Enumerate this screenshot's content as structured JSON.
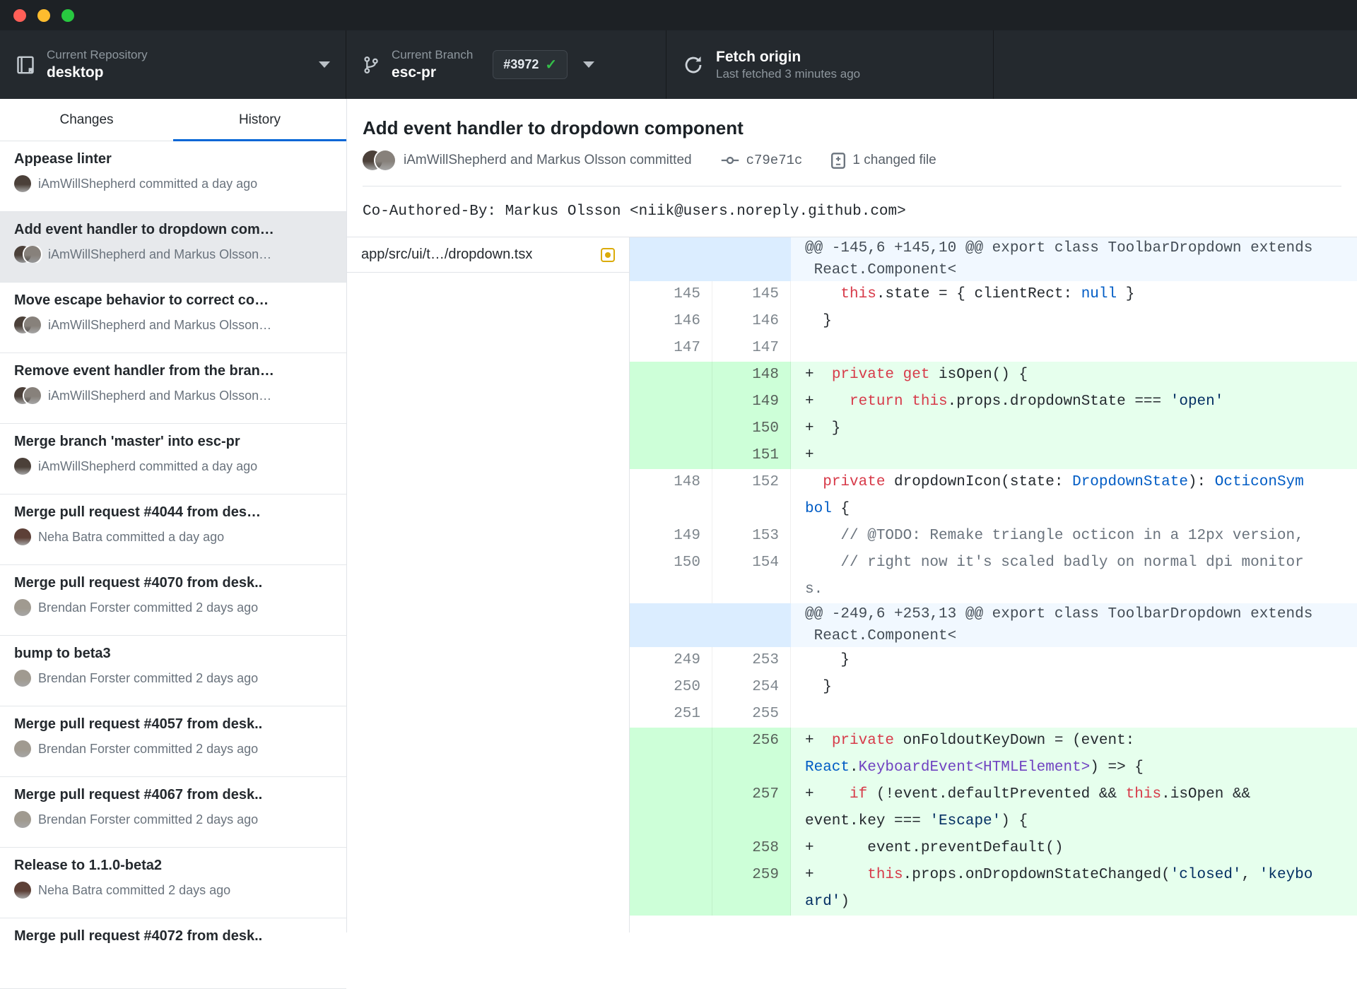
{
  "toolbar": {
    "repository": {
      "label": "Current Repository",
      "value": "desktop"
    },
    "branch": {
      "label": "Current Branch",
      "value": "esc-pr",
      "badge": "#3972",
      "check": "✓"
    },
    "fetch": {
      "title": "Fetch origin",
      "subtitle": "Last fetched 3 minutes ago"
    }
  },
  "sidebar": {
    "tabs": [
      {
        "label": "Changes",
        "active": false
      },
      {
        "label": "History",
        "active": true
      }
    ],
    "history": [
      {
        "title": "Appease linter",
        "meta": "iAmWillShepherd committed a day ago",
        "avatars": [
          "iAmWillShepherd"
        ],
        "selected": false
      },
      {
        "title": "Add event handler to dropdown com…",
        "meta": "iAmWillShepherd and Markus Olsson…",
        "avatars": [
          "iAmWillShepherd",
          "MarkusOlsson"
        ],
        "selected": true
      },
      {
        "title": "Move escape behavior to correct co…",
        "meta": "iAmWillShepherd and Markus Olsson…",
        "avatars": [
          "iAmWillShepherd",
          "MarkusOlsson"
        ],
        "selected": false
      },
      {
        "title": "Remove event handler from the bran…",
        "meta": "iAmWillShepherd and Markus Olsson…",
        "avatars": [
          "iAmWillShepherd",
          "MarkusOlsson"
        ],
        "selected": false
      },
      {
        "title": "Merge branch 'master' into esc-pr",
        "meta": "iAmWillShepherd committed a day ago",
        "avatars": [
          "iAmWillShepherd"
        ],
        "selected": false
      },
      {
        "title": "Merge pull request #4044 from des…",
        "meta": "Neha Batra committed a day ago",
        "avatars": [
          "NehaBatra"
        ],
        "selected": false
      },
      {
        "title": "Merge pull request #4070 from desk..",
        "meta": "Brendan Forster committed 2 days ago",
        "avatars": [
          "BrendanForster"
        ],
        "selected": false
      },
      {
        "title": "bump to beta3",
        "meta": "Brendan Forster committed 2 days ago",
        "avatars": [
          "BrendanForster"
        ],
        "selected": false
      },
      {
        "title": "Merge pull request #4057 from desk..",
        "meta": "Brendan Forster committed 2 days ago",
        "avatars": [
          "BrendanForster"
        ],
        "selected": false
      },
      {
        "title": "Merge pull request #4067 from desk..",
        "meta": "Brendan Forster committed 2 days ago",
        "avatars": [
          "BrendanForster"
        ],
        "selected": false
      },
      {
        "title": "Release to 1.1.0-beta2",
        "meta": "Neha Batra committed 2 days ago",
        "avatars": [
          "NehaBatra"
        ],
        "selected": false
      },
      {
        "title": "Merge pull request #4072 from desk..",
        "meta": "",
        "avatars": [],
        "selected": false
      }
    ]
  },
  "commit": {
    "title": "Add event handler to dropdown component",
    "byline": "iAmWillShepherd and Markus Olsson committed",
    "byline_avatars": [
      "iAmWillShepherd",
      "MarkusOlsson"
    ],
    "sha": "c79e71c",
    "files_changed": "1 changed file",
    "description": "Co-Authored-By: Markus Olsson <niik@users.noreply.github.com>"
  },
  "diff": {
    "file": {
      "path": "app/src/ui/t…/dropdown.tsx",
      "status": "modified"
    },
    "rows": [
      {
        "kind": "hunk",
        "old": "",
        "new": "",
        "lines": [
          [
            [
              "h",
              "@@ -145,6 +145,10 @@ export class ToolbarDropdown extends"
            ]
          ],
          [
            [
              "h",
              " React.Component<"
            ]
          ]
        ]
      },
      {
        "kind": "ctx",
        "old": "145",
        "new": "145",
        "lines": [
          [
            [
              "p",
              "    "
            ],
            [
              "k",
              "this"
            ],
            [
              "p",
              ".state = { clientRect: "
            ],
            [
              "b",
              "null"
            ],
            [
              "p",
              " }"
            ]
          ]
        ]
      },
      {
        "kind": "ctx",
        "old": "146",
        "new": "146",
        "lines": [
          [
            [
              "p",
              "  }"
            ]
          ]
        ]
      },
      {
        "kind": "ctx",
        "old": "147",
        "new": "147",
        "lines": [
          [
            [
              "p",
              ""
            ]
          ]
        ]
      },
      {
        "kind": "add",
        "old": "",
        "new": "148",
        "lines": [
          [
            [
              "p",
              "+  "
            ],
            [
              "k",
              "private"
            ],
            [
              "p",
              " "
            ],
            [
              "k",
              "get"
            ],
            [
              "p",
              " isOpen() {"
            ]
          ]
        ]
      },
      {
        "kind": "add",
        "old": "",
        "new": "149",
        "lines": [
          [
            [
              "p",
              "+    "
            ],
            [
              "k",
              "return"
            ],
            [
              "p",
              " "
            ],
            [
              "k",
              "this"
            ],
            [
              "p",
              ".props.dropdownState === "
            ],
            [
              "s",
              "'open'"
            ]
          ]
        ]
      },
      {
        "kind": "add",
        "old": "",
        "new": "150",
        "lines": [
          [
            [
              "p",
              "+  }"
            ]
          ]
        ]
      },
      {
        "kind": "add",
        "old": "",
        "new": "151",
        "lines": [
          [
            [
              "p",
              "+"
            ]
          ]
        ]
      },
      {
        "kind": "ctx",
        "old": "148",
        "new": "152",
        "lines": [
          [
            [
              "p",
              "  "
            ],
            [
              "k",
              "private"
            ],
            [
              "p",
              " dropdownIcon(state: "
            ],
            [
              "b",
              "DropdownState"
            ],
            [
              "p",
              "): "
            ],
            [
              "b",
              "OcticonSym"
            ]
          ],
          [
            [
              "b",
              "bol"
            ],
            [
              "p",
              " {"
            ]
          ]
        ]
      },
      {
        "kind": "ctx",
        "old": "149",
        "new": "153",
        "lines": [
          [
            [
              "c",
              "    // @TODO: Remake triangle octicon in a 12px version,"
            ]
          ]
        ]
      },
      {
        "kind": "ctx",
        "old": "150",
        "new": "154",
        "lines": [
          [
            [
              "c",
              "    // right now it's scaled badly on normal dpi monitor"
            ]
          ],
          [
            [
              "c",
              "s."
            ]
          ]
        ]
      },
      {
        "kind": "hunk",
        "old": "",
        "new": "",
        "lines": [
          [
            [
              "h",
              "@@ -249,6 +253,13 @@ export class ToolbarDropdown extends"
            ]
          ],
          [
            [
              "h",
              " React.Component<"
            ]
          ]
        ]
      },
      {
        "kind": "ctx",
        "old": "249",
        "new": "253",
        "lines": [
          [
            [
              "p",
              "    }"
            ]
          ]
        ]
      },
      {
        "kind": "ctx",
        "old": "250",
        "new": "254",
        "lines": [
          [
            [
              "p",
              "  }"
            ]
          ]
        ]
      },
      {
        "kind": "ctx",
        "old": "251",
        "new": "255",
        "lines": [
          [
            [
              "p",
              ""
            ]
          ]
        ]
      },
      {
        "kind": "add",
        "old": "",
        "new": "256",
        "lines": [
          [
            [
              "p",
              "+  "
            ],
            [
              "k",
              "private"
            ],
            [
              "p",
              " onFoldoutKeyDown = (event:"
            ]
          ],
          [
            [
              "b",
              "React"
            ],
            [
              "p",
              "."
            ],
            [
              "u",
              "KeyboardEvent<HTMLElement>"
            ],
            [
              "p",
              ") => {"
            ]
          ]
        ]
      },
      {
        "kind": "add",
        "old": "",
        "new": "257",
        "lines": [
          [
            [
              "p",
              "+    "
            ],
            [
              "k",
              "if"
            ],
            [
              "p",
              " (!event.defaultPrevented && "
            ],
            [
              "k",
              "this"
            ],
            [
              "p",
              ".isOpen &&"
            ]
          ],
          [
            [
              "p",
              "event.key === "
            ],
            [
              "s",
              "'Escape'"
            ],
            [
              "p",
              ") {"
            ]
          ]
        ]
      },
      {
        "kind": "add",
        "old": "",
        "new": "258",
        "lines": [
          [
            [
              "p",
              "+      event.preventDefault()"
            ]
          ]
        ]
      },
      {
        "kind": "add",
        "old": "",
        "new": "259",
        "lines": [
          [
            [
              "p",
              "+      "
            ],
            [
              "k",
              "this"
            ],
            [
              "p",
              ".props.onDropdownStateChanged("
            ],
            [
              "s",
              "'closed'"
            ],
            [
              "p",
              ", "
            ],
            [
              "s",
              "'keybo"
            ]
          ],
          [
            [
              "s",
              "ard'"
            ],
            [
              "p",
              ")"
            ]
          ]
        ]
      }
    ]
  },
  "colors": {
    "accent": "#0366d6",
    "added_bg": "#e6ffed",
    "added_gutter_bg": "#cdffd8",
    "hunk_bg": "#f1f8ff",
    "hunk_gutter_bg": "#dbedff",
    "modified_status": "#dbab09",
    "keyword": "#d73a49",
    "string": "#032f62",
    "type_blue": "#005cc5",
    "type_purple": "#6f42c1",
    "comment": "#6a737d",
    "check_green": "#34bf49"
  }
}
